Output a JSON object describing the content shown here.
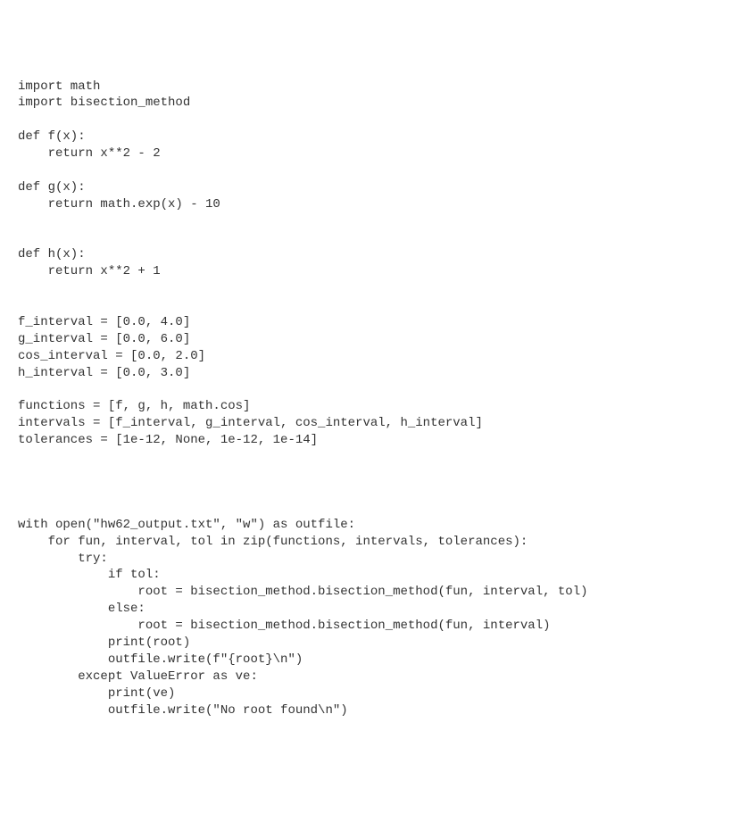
{
  "code": {
    "lines": [
      "import math",
      "import bisection_method",
      "",
      "def f(x):",
      "    return x**2 - 2",
      "",
      "def g(x):",
      "    return math.exp(x) - 10",
      "",
      "",
      "def h(x):",
      "    return x**2 + 1",
      "",
      "",
      "f_interval = [0.0, 4.0]",
      "g_interval = [0.0, 6.0]",
      "cos_interval = [0.0, 2.0]",
      "h_interval = [0.0, 3.0]",
      "",
      "functions = [f, g, h, math.cos]",
      "intervals = [f_interval, g_interval, cos_interval, h_interval]",
      "tolerances = [1e-12, None, 1e-12, 1e-14]",
      "",
      "",
      "",
      "",
      "with open(\"hw62_output.txt\", \"w\") as outfile:",
      "    for fun, interval, tol in zip(functions, intervals, tolerances):",
      "        try:",
      "            if tol:",
      "                root = bisection_method.bisection_method(fun, interval, tol)",
      "            else:",
      "                root = bisection_method.bisection_method(fun, interval)",
      "            print(root)",
      "            outfile.write(f\"{root}\\n\")",
      "        except ValueError as ve:",
      "            print(ve)",
      "            outfile.write(\"No root found\\n\")"
    ]
  }
}
